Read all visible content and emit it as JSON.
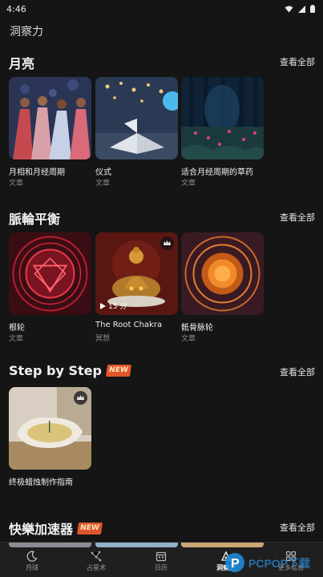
{
  "status": {
    "time": "4:46"
  },
  "app_title": "洞察力",
  "see_all_label": "查看全部",
  "new_badge": "NEW",
  "sections": [
    {
      "title": "月亮",
      "cards": [
        {
          "title": "月相和月经周期",
          "subtitle": "文章"
        },
        {
          "title": "仪式",
          "subtitle": "文章"
        },
        {
          "title": "适合月经周期的草药",
          "subtitle": "文章"
        }
      ]
    },
    {
      "title": "脈輪平衡",
      "cards": [
        {
          "title": "根轮",
          "subtitle": "文章"
        },
        {
          "title": "The Root Chakra",
          "subtitle": "冥想",
          "duration": "15 分",
          "premium": true
        },
        {
          "title": "骶骨脉轮",
          "subtitle": "文章"
        }
      ]
    },
    {
      "title": "Step by Step",
      "badge": true,
      "cards": [
        {
          "title": "终极蜡烛制作指南",
          "subtitle": "",
          "premium": true
        }
      ]
    },
    {
      "title": "快樂加速器",
      "badge": true,
      "cards": []
    }
  ],
  "bottom_nav": [
    {
      "label": "月球",
      "icon": "moon-icon"
    },
    {
      "label": "占星术",
      "icon": "constellation-icon"
    },
    {
      "label": "日历",
      "icon": "calendar-icon"
    },
    {
      "label": "洞察力",
      "icon": "insight-icon",
      "active": true
    },
    {
      "label": "更多信息",
      "icon": "grid-icon"
    }
  ],
  "watermark": "PCPOP下载"
}
